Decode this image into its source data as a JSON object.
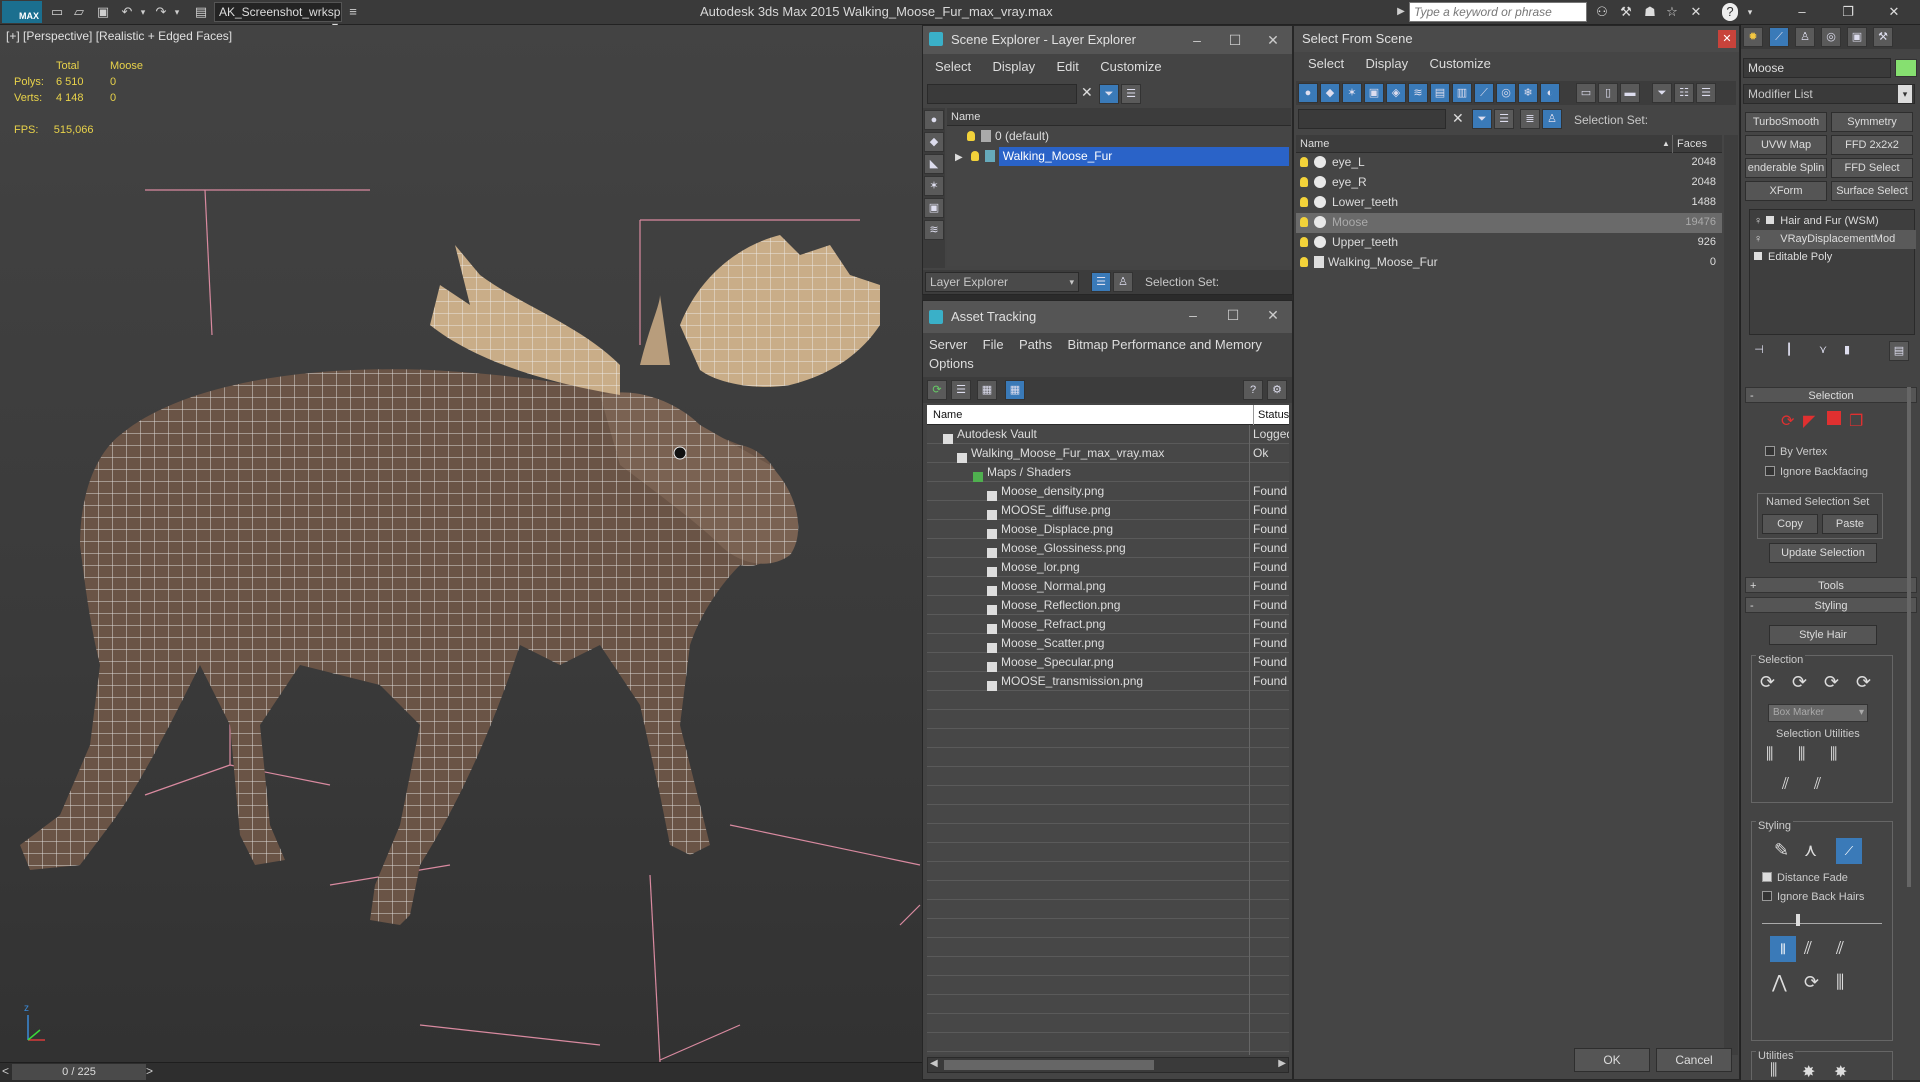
{
  "app": {
    "logo": "MAX",
    "title": "Autodesk 3ds Max  2015     Walking_Moose_Fur_max_vray.max",
    "workspace": "AK_Screenshot_wrksp",
    "search_placeholder": "Type a keyword or phrase"
  },
  "viewport": {
    "label": "[+] [Perspective] [Realistic + Edged Faces]",
    "stats": {
      "col_total": "Total",
      "col_moose": "Moose",
      "polys_label": "Polys:",
      "polys_total": "6 510",
      "polys_moose": "0",
      "verts_label": "Verts:",
      "verts_total": "4 148",
      "verts_moose": "0",
      "fps_label": "FPS:",
      "fps_value": "515,066"
    }
  },
  "timeline": {
    "frame": "0 / 225",
    "prev": "<",
    "next": ">"
  },
  "scene_explorer": {
    "title": "Scene Explorer - Layer Explorer",
    "menu": [
      "Select",
      "Display",
      "Edit",
      "Customize"
    ],
    "col_name": "Name",
    "layers": [
      "0 (default)",
      "Walking_Moose_Fur"
    ],
    "footer_combo": "Layer Explorer",
    "selection_set": "Selection Set:"
  },
  "asset_tracking": {
    "title": "Asset Tracking",
    "menu": [
      "Server",
      "File",
      "Paths",
      "Bitmap Performance and Memory"
    ],
    "menu2": "Options",
    "col_name": "Name",
    "col_status": "Status",
    "rows": [
      {
        "name": "Autodesk Vault",
        "status": "Logged"
      },
      {
        "name": "Walking_Moose_Fur_max_vray.max",
        "status": "Ok"
      },
      {
        "name": "Maps / Shaders",
        "status": ""
      },
      {
        "name": "Moose_density.png",
        "status": "Found"
      },
      {
        "name": "MOOSE_diffuse.png",
        "status": "Found"
      },
      {
        "name": "Moose_Displace.png",
        "status": "Found"
      },
      {
        "name": "Moose_Glossiness.png",
        "status": "Found"
      },
      {
        "name": "Moose_lor.png",
        "status": "Found"
      },
      {
        "name": "Moose_Normal.png",
        "status": "Found"
      },
      {
        "name": "Moose_Reflection.png",
        "status": "Found"
      },
      {
        "name": "Moose_Refract.png",
        "status": "Found"
      },
      {
        "name": "Moose_Scatter.png",
        "status": "Found"
      },
      {
        "name": "Moose_Specular.png",
        "status": "Found"
      },
      {
        "name": "MOOSE_transmission.png",
        "status": "Found"
      }
    ]
  },
  "select_from_scene": {
    "title": "Select From Scene",
    "menu": [
      "Select",
      "Display",
      "Customize"
    ],
    "selection_set": "Selection Set:",
    "col_name": "Name",
    "col_faces": "Faces",
    "rows": [
      {
        "name": "eye_L",
        "faces": "2048"
      },
      {
        "name": "eye_R",
        "faces": "2048"
      },
      {
        "name": "Lower_teeth",
        "faces": "1488"
      },
      {
        "name": "Moose",
        "faces": "19476"
      },
      {
        "name": "Upper_teeth",
        "faces": "926"
      },
      {
        "name": "Walking_Moose_Fur",
        "faces": "0"
      }
    ],
    "ok": "OK",
    "cancel": "Cancel"
  },
  "command_panel": {
    "object_name": "Moose",
    "modifier_list": "Modifier List",
    "buttons": [
      "TurboSmooth",
      "Symmetry",
      "UVW Map",
      "FFD 2x2x2",
      "enderable Splin",
      "FFD Select",
      "XForm",
      "Surface Select"
    ],
    "stack": [
      "Hair and Fur (WSM)",
      "VRayDisplacementMod",
      "Editable Poly"
    ],
    "selection_rollout": "Selection",
    "by_vertex": "By Vertex",
    "ignore_backfacing": "Ignore Backfacing",
    "named_sel": "Named Selection Set",
    "copy": "Copy",
    "paste": "Paste",
    "update_selection": "Update Selection",
    "tools_rollout": "Tools",
    "styling_rollout": "Styling",
    "style_hair": "Style Hair",
    "selection_group": "Selection",
    "box_marker": "Box Marker",
    "selection_utilities": "Selection Utilities",
    "styling_group": "Styling",
    "distance_fade": "Distance Fade",
    "ignore_back_hairs": "Ignore Back Hairs",
    "utilities_group": "Utilities"
  }
}
